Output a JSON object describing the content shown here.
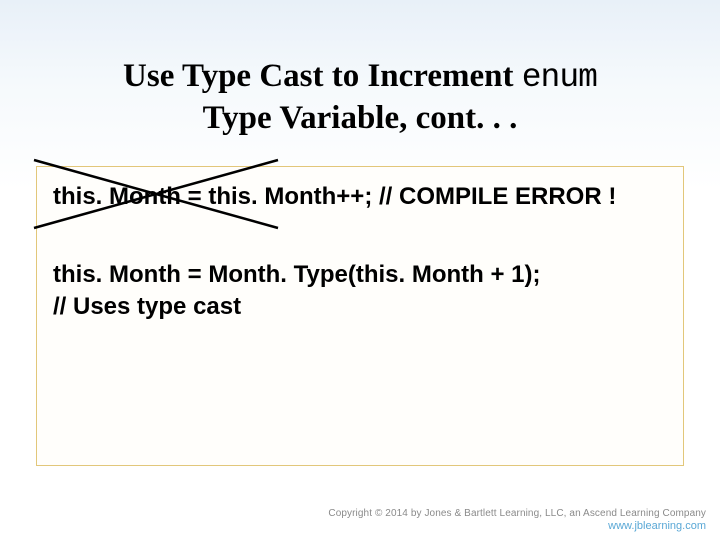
{
  "title": {
    "part1": "Use Type Cast to Increment ",
    "enum_word": "enum",
    "part2": " Type Variable, cont. . ."
  },
  "code": {
    "line1": "this. Month = this. Month++; // COMPILE ERROR !",
    "line2": "this. Month = Month. Type(this. Month + 1);",
    "line3": "// Uses type cast"
  },
  "footer": {
    "copyright": "Copyright © 2014 by Jones & Bartlett Learning, LLC, an Ascend Learning Company",
    "url": "www.jblearning.com"
  }
}
